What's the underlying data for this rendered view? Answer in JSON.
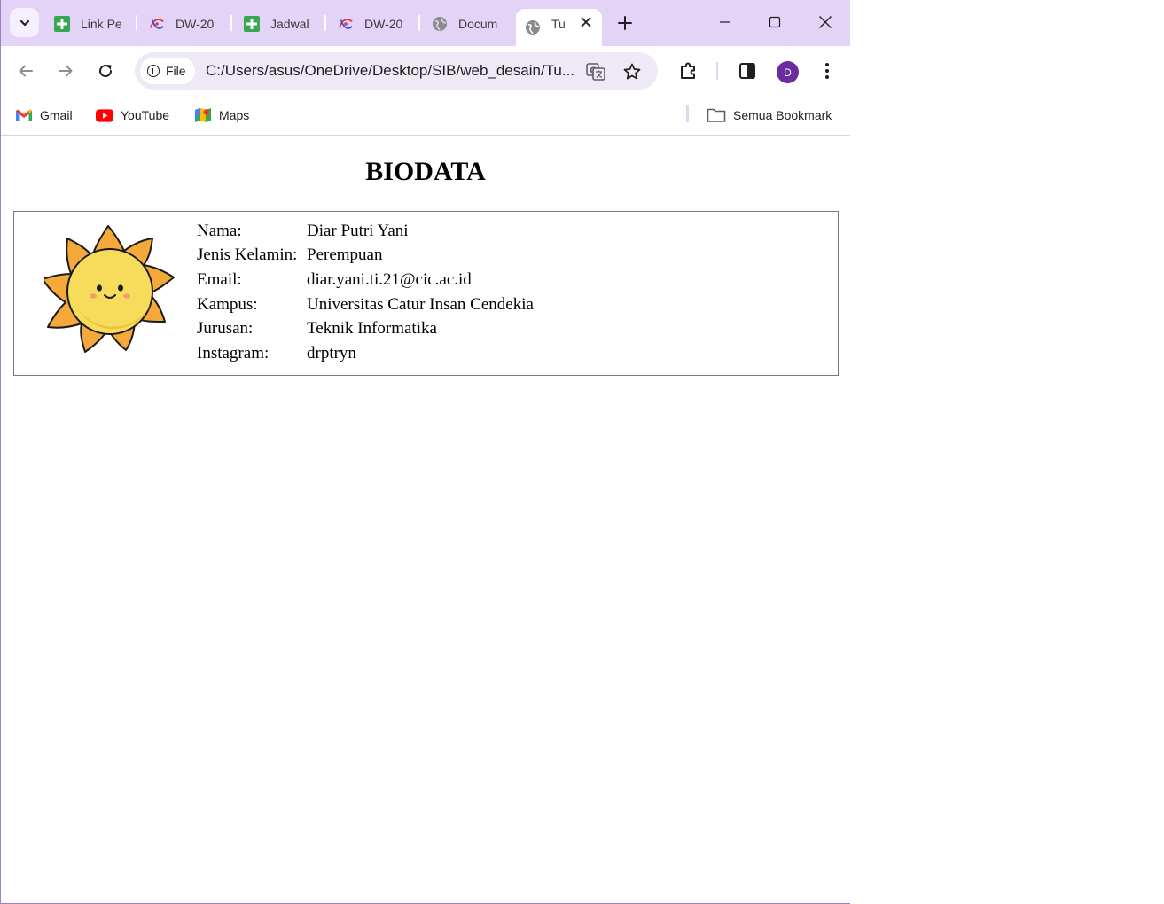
{
  "tabs": [
    {
      "label": "Link Pe",
      "icon": "sheets-icon"
    },
    {
      "label": "DW-20",
      "icon": "dw-logo-icon"
    },
    {
      "label": "Jadwal",
      "icon": "sheets-icon"
    },
    {
      "label": "DW-20",
      "icon": "dw-logo-icon"
    },
    {
      "label": "Docum",
      "icon": "globe-icon"
    },
    {
      "label": "Tu",
      "icon": "globe-icon",
      "active": true
    }
  ],
  "address_bar": {
    "chip_label": "File",
    "url": "C:/Users/asus/OneDrive/Desktop/SIB/web_desain/Tu..."
  },
  "profile": {
    "initial": "D",
    "color": "#6a2c9e"
  },
  "bookmarks": [
    {
      "label": "Gmail",
      "icon": "gmail-icon"
    },
    {
      "label": "YouTube",
      "icon": "youtube-icon"
    },
    {
      "label": "Maps",
      "icon": "maps-icon"
    }
  ],
  "all_bookmarks_label": "Semua Bookmark",
  "page": {
    "title": "BIODATA",
    "rows": [
      {
        "key": "Nama:",
        "value": "Diar Putri Yani"
      },
      {
        "key": "Jenis Kelamin:",
        "value": "Perempuan"
      },
      {
        "key": "Email:",
        "value": "diar.yani.ti.21@cic.ac.id"
      },
      {
        "key": "Kampus:",
        "value": "Universitas Catur Insan Cendekia"
      },
      {
        "key": "Jurusan:",
        "value": "Teknik Informatika"
      },
      {
        "key": "Instagram:",
        "value": "drptryn"
      }
    ]
  },
  "colors": {
    "tabstrip": "#e3d4f7",
    "omnibox": "#efe8f6",
    "sun_petal": "#f5a93a",
    "sun_face": "#f7dc5b"
  }
}
